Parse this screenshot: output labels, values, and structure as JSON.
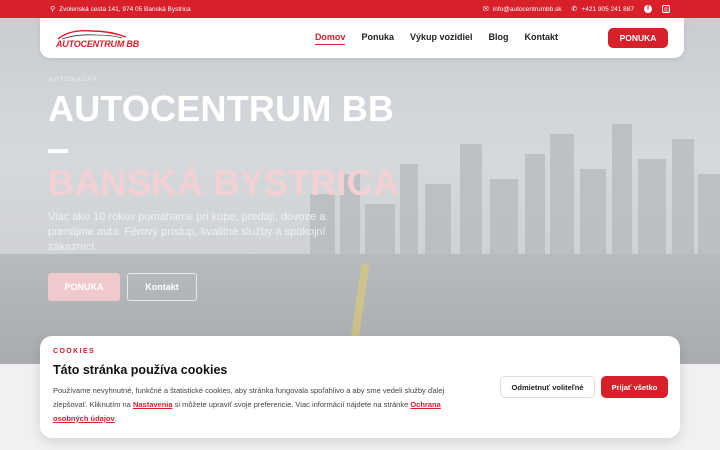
{
  "topbar": {
    "address": "Zvolenská cesta 141, 974 05 Banská Bystrica",
    "email": "info@autocentrumbb.sk",
    "phone": "+421 905 241 887"
  },
  "nav": {
    "logo_text": "AUTOCENTRUM BB",
    "items": [
      "Domov",
      "Ponuka",
      "Výkup vozidiel",
      "Blog",
      "Kontakt"
    ],
    "cta": "PONUKA"
  },
  "hero": {
    "eyebrow": "AUTOBAZÁR",
    "title_line1": "AUTOCENTRUM BB",
    "title_line2": "BANSKÁ BYSTRICA",
    "description": "Viac ako 10 rokov pomáhame pri kúpe, predaji, dovoze a prenájme auta. Férový prístup, kvalitné služby a spokojní zákazníci.",
    "btn_primary": "PONUKA",
    "btn_secondary": "Kontakt"
  },
  "cookie": {
    "kicker": "COOKIES",
    "title": "Táto stránka používa cookies",
    "text_part1": "Používame nevyhnutné, funkčné a štatistické cookies, aby stránka fungovala spoľahlivo a aby sme vedeli služby ďalej zlepšovať. Kliknutím na ",
    "link_settings": "Nastavenia",
    "text_part2": " si môžete upraviť svoje preferencie. Viac informácií nájdete na stránke ",
    "link_privacy": "Ochrana osobných údajov",
    "text_part3": ".",
    "btn_reject": "Odmietnuť voliteľné",
    "btn_accept": "Prijať všetko"
  },
  "colors": {
    "brand": "#d8202a"
  }
}
